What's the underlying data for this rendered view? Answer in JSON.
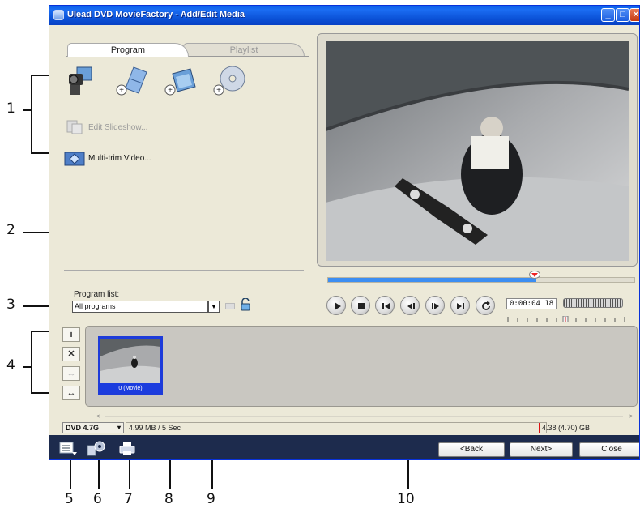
{
  "window": {
    "title": "Ulead DVD MovieFactory - Add/Edit Media",
    "minimize": "_",
    "maximize": "□",
    "close": "×"
  },
  "tabs": {
    "program": "Program",
    "playlist": "Playlist"
  },
  "media_buttons": [
    {
      "icon": "camcorder-capture-icon"
    },
    {
      "icon": "add-video-files-icon"
    },
    {
      "icon": "add-slideshow-icon"
    },
    {
      "icon": "import-dvd-icon"
    }
  ],
  "actions": {
    "edit_slideshow": "Edit Slideshow...",
    "multitrim_video": "Multi-trim Video..."
  },
  "program_list": {
    "label": "Program list:",
    "value": "All programs"
  },
  "player": {
    "timecode": "0:00:04 18",
    "progress": 0.68
  },
  "side_tools": [
    "i",
    "✕",
    "↔",
    "↔"
  ],
  "media": {
    "clip_label": "0 (Movie)"
  },
  "status": {
    "disc_type": "DVD 4.7G",
    "size": "4.99 MB / 5 Sec",
    "capacity": "4.38 (4.70) GB"
  },
  "buttons": {
    "back": "<Back",
    "next": "Next>",
    "close": "Close"
  },
  "callouts": [
    "1",
    "2",
    "3",
    "4",
    "5",
    "6",
    "7",
    "8",
    "9",
    "10"
  ],
  "colors": {
    "titlebar": "#0a5ee8",
    "panel": "#ece9d8",
    "bottom_bar": "#1d2b4d",
    "selection": "#1b3cde",
    "progress": "#3c8ef2"
  }
}
